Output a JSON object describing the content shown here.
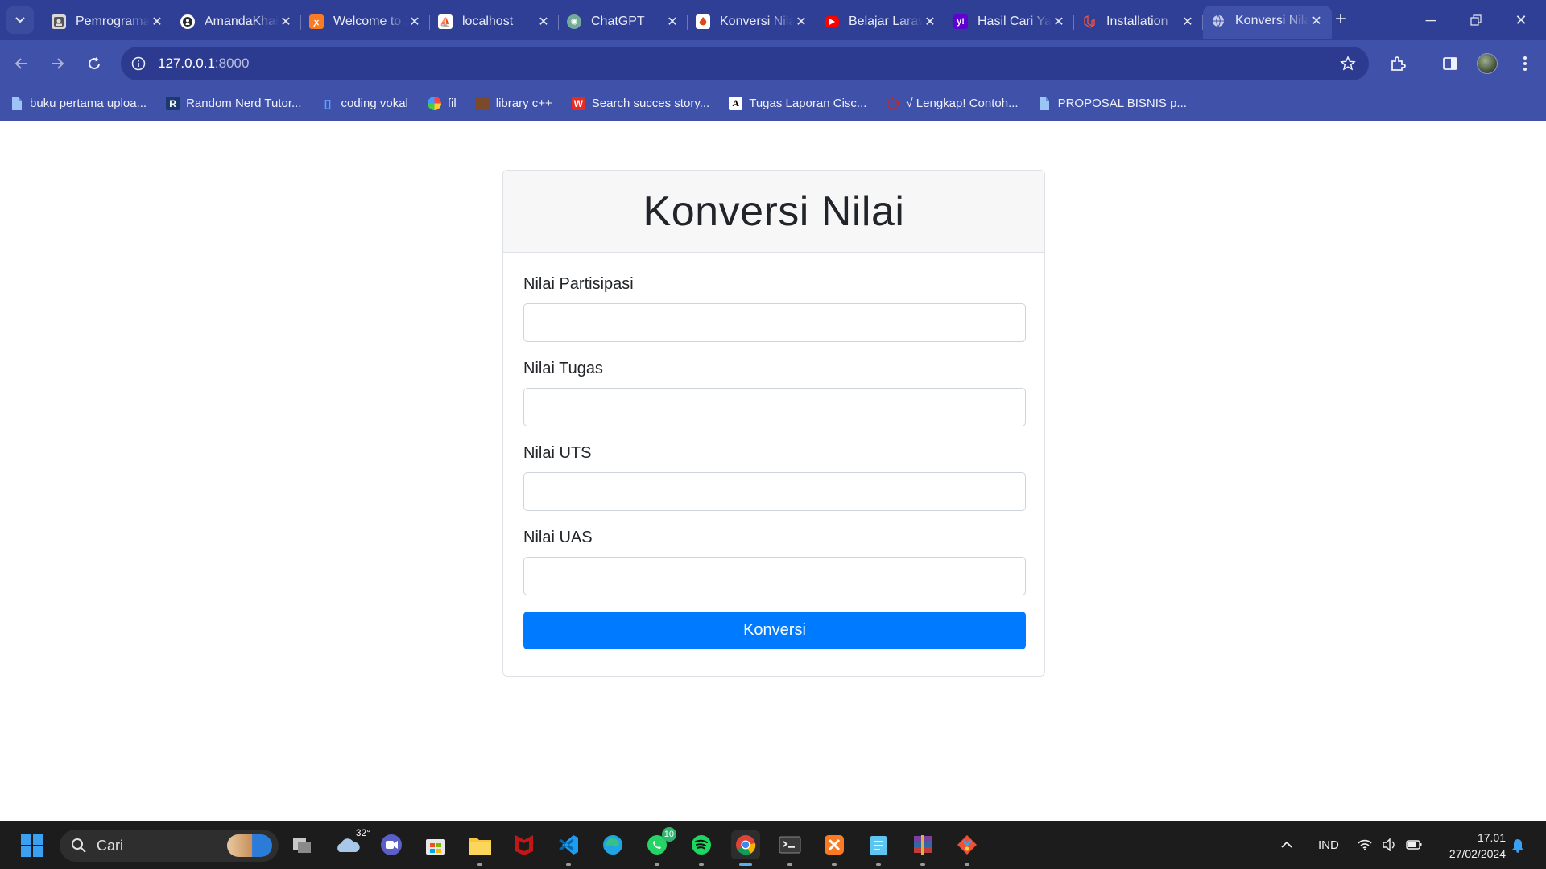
{
  "browser": {
    "tabs": [
      {
        "title": "Pemrograman",
        "icon": "page-icon",
        "active": false
      },
      {
        "title": "AmandaKhairunnisa",
        "icon": "github-icon",
        "active": false
      },
      {
        "title": "Welcome to XAMPP",
        "icon": "xampp-icon",
        "active": false
      },
      {
        "title": "localhost",
        "icon": "phpmyadmin-icon",
        "active": false
      },
      {
        "title": "ChatGPT",
        "icon": "chatgpt-icon",
        "active": false
      },
      {
        "title": "Konversi Nilai",
        "icon": "codeigniter-icon",
        "active": false
      },
      {
        "title": "Belajar Laravel",
        "icon": "youtube-icon",
        "active": false
      },
      {
        "title": "Hasil Cari Yahoo",
        "icon": "yahoo-icon",
        "active": false
      },
      {
        "title": "Installation",
        "icon": "laravel-icon",
        "active": false
      },
      {
        "title": "Konversi Nilai",
        "icon": "globe-icon",
        "active": true
      }
    ],
    "url_host": "127.0.0.1",
    "url_port": ":8000",
    "bookmarks": [
      {
        "label": "buku pertama uploa...",
        "icon": "doc-icon"
      },
      {
        "label": "Random Nerd Tutor...",
        "icon": "r-icon"
      },
      {
        "label": "coding vokal",
        "icon": "bracket-icon"
      },
      {
        "label": "fil",
        "icon": "colorful-icon"
      },
      {
        "label": "library c++",
        "icon": "photo-icon"
      },
      {
        "label": "Search succes story...",
        "icon": "w-icon"
      },
      {
        "label": "Tugas Laporan Cisc...",
        "icon": "a-icon"
      },
      {
        "label": "√ Lengkap! Contoh...",
        "icon": "red-logo-icon"
      },
      {
        "label": "PROPOSAL BISNIS p...",
        "icon": "doc-icon"
      }
    ]
  },
  "page": {
    "title": "Konversi Nilai",
    "fields": [
      {
        "label": "Nilai Partisipasi",
        "value": ""
      },
      {
        "label": "Nilai Tugas",
        "value": ""
      },
      {
        "label": "Nilai UTS",
        "value": ""
      },
      {
        "label": "Nilai UAS",
        "value": ""
      }
    ],
    "submit_label": "Konversi",
    "accent_color": "#007bff"
  },
  "taskbar": {
    "search_label": "Cari",
    "weather_temp": "32°",
    "whatsapp_badge": "10",
    "language": "IND",
    "time": "17.01",
    "date": "27/02/2024"
  }
}
